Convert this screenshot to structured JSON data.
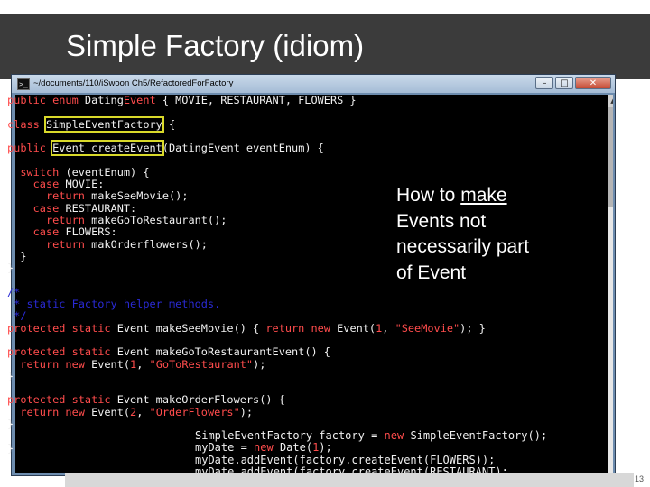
{
  "slide": {
    "title": "Simple Factory (idiom)",
    "page_number": "13"
  },
  "window": {
    "path": "~/documents/110/iSwoon Ch5/RefactoredForFactory",
    "buttons": {
      "minimize": "–",
      "maximize": "□",
      "close": "✕"
    }
  },
  "code_lines": [
    [
      [
        "kw",
        "public enum "
      ],
      [
        "t",
        "Dating"
      ],
      [
        "kw",
        "Event"
      ],
      [
        "t",
        " { MOVIE, RESTAURANT, FLOWERS }"
      ]
    ],
    [
      [
        "t",
        ""
      ]
    ],
    [
      [
        "kw",
        "class "
      ],
      [
        "hl",
        "Simple"
      ],
      [
        "hl",
        "Event"
      ],
      [
        "hl",
        "Factory"
      ],
      [
        "t",
        " {"
      ]
    ],
    [
      [
        "t",
        ""
      ]
    ],
    [
      [
        "kw",
        "public "
      ],
      [
        "hl",
        "Event"
      ],
      [
        "hl",
        " create"
      ],
      [
        "hl",
        "Event"
      ],
      [
        "t",
        "(Dating"
      ],
      [
        "t",
        "Event event"
      ],
      [
        "t",
        "Enum) {"
      ]
    ],
    [
      [
        "t",
        ""
      ]
    ],
    [
      [
        "kw",
        "  switch "
      ],
      [
        "t",
        "(event"
      ],
      [
        "t",
        "Enum) {"
      ]
    ],
    [
      [
        "kw",
        "    case "
      ],
      [
        "t",
        "MOVIE:"
      ]
    ],
    [
      [
        "kw",
        "      return "
      ],
      [
        "t",
        "make"
      ],
      [
        "t",
        "See"
      ],
      [
        "t",
        "Movie();"
      ]
    ],
    [
      [
        "kw",
        "    case "
      ],
      [
        "t",
        "RESTAURANT:"
      ]
    ],
    [
      [
        "kw",
        "      return "
      ],
      [
        "t",
        "make"
      ],
      [
        "t",
        "GoTo"
      ],
      [
        "t",
        "Restaurant();"
      ]
    ],
    [
      [
        "kw",
        "    case "
      ],
      [
        "t",
        "FLOWERS:"
      ]
    ],
    [
      [
        "kw",
        "      return "
      ],
      [
        "t",
        "mak"
      ],
      [
        "t",
        "Order"
      ],
      [
        "t",
        "flowers();"
      ]
    ],
    [
      [
        "t",
        "  }"
      ]
    ],
    [
      [
        "t",
        "}"
      ]
    ],
    [
      [
        "t",
        ""
      ]
    ],
    [
      [
        "cm",
        "/*"
      ]
    ],
    [
      [
        "cm",
        " * static Factory helper methods."
      ]
    ],
    [
      [
        "cm",
        " */"
      ]
    ],
    [
      [
        "kw",
        "protected static "
      ],
      [
        "t",
        "Event make"
      ],
      [
        "t",
        "See"
      ],
      [
        "t",
        "Movie() { "
      ],
      [
        "kw",
        "return new "
      ],
      [
        "t",
        "Event("
      ],
      [
        "num",
        "1"
      ],
      [
        "t",
        ", "
      ],
      [
        "str",
        "\"See"
      ],
      [
        "str",
        "Movie\""
      ],
      [
        "t",
        "); }"
      ]
    ],
    [
      [
        "t",
        ""
      ]
    ],
    [
      [
        "kw",
        "protected static "
      ],
      [
        "t",
        "Event make"
      ],
      [
        "t",
        "GoTo"
      ],
      [
        "t",
        "Restaurant"
      ],
      [
        "t",
        "Event() {"
      ]
    ],
    [
      [
        "kw",
        "  return new "
      ],
      [
        "t",
        "Event("
      ],
      [
        "num",
        "1"
      ],
      [
        "t",
        ", "
      ],
      [
        "str",
        "\"GoTo"
      ],
      [
        "str",
        "Restaurant\""
      ],
      [
        "t",
        ");"
      ]
    ],
    [
      [
        "t",
        "}"
      ]
    ],
    [
      [
        "t",
        ""
      ]
    ],
    [
      [
        "kw",
        "protected static "
      ],
      [
        "t",
        "Event make"
      ],
      [
        "t",
        "Order"
      ],
      [
        "t",
        "Flowers() {"
      ]
    ],
    [
      [
        "kw",
        "  return new "
      ],
      [
        "t",
        "Event("
      ],
      [
        "num",
        "2"
      ],
      [
        "t",
        ", "
      ],
      [
        "str",
        "\"Order"
      ],
      [
        "str",
        "Flowers\""
      ],
      [
        "t",
        ");"
      ]
    ],
    [
      [
        "t",
        "}"
      ]
    ],
    [
      [
        "t",
        ""
      ]
    ],
    [
      [
        "t",
        "}"
      ]
    ]
  ],
  "overlay_lines": [
    [
      [
        "t",
        "Simple"
      ],
      [
        "t",
        "Event"
      ],
      [
        "t",
        "Factory factory = "
      ],
      [
        "kw",
        "new "
      ],
      [
        "t",
        "Simple"
      ],
      [
        "t",
        "Event"
      ],
      [
        "t",
        "Factory();"
      ]
    ],
    [
      [
        "t",
        "my"
      ],
      [
        "t",
        "Date = "
      ],
      [
        "kw",
        "new "
      ],
      [
        "t",
        "Date("
      ],
      [
        "kw",
        "1"
      ],
      [
        "t",
        ");"
      ]
    ],
    [
      [
        "t",
        "my"
      ],
      [
        "t",
        "Date.add"
      ],
      [
        "t",
        "Event(factory.create"
      ],
      [
        "t",
        "Event(FLOWERS));"
      ]
    ],
    [
      [
        "t",
        "my"
      ],
      [
        "t",
        "Date.add"
      ],
      [
        "t",
        "Event(factory.create"
      ],
      [
        "t",
        "Event(RESTAURANT);"
      ]
    ]
  ],
  "callout": {
    "line1_a": "How to ",
    "line1_b": "make",
    "line2": "Events not",
    "line3": "necessarily part",
    "line4": "of Event"
  },
  "colors": {
    "keyword": "#ff4c4c",
    "comment": "#2a2ad6",
    "highlight": "#d9d92a",
    "title_bar": "#3b3b3b"
  }
}
